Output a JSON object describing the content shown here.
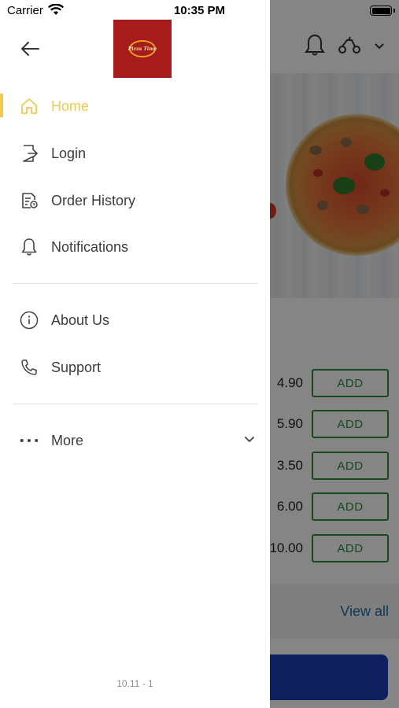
{
  "status_bar": {
    "carrier": "Carrier",
    "time": "10:35 PM"
  },
  "drawer": {
    "logo_text": "Pizza Time",
    "menu": [
      {
        "label": "Home",
        "icon": "home-icon",
        "active": true
      },
      {
        "label": "Login",
        "icon": "login-icon",
        "active": false
      },
      {
        "label": "Order History",
        "icon": "order-history-icon",
        "active": false
      },
      {
        "label": "Notifications",
        "icon": "bell-icon",
        "active": false
      },
      {
        "label": "About Us",
        "icon": "info-icon",
        "active": false
      },
      {
        "label": "Support",
        "icon": "phone-icon",
        "active": false
      },
      {
        "label": "More",
        "icon": "more-dots-icon",
        "active": false
      }
    ],
    "version": "10.11 - 1"
  },
  "background": {
    "products": [
      {
        "price": "4.90",
        "add_label": "ADD"
      },
      {
        "price": "5.90",
        "add_label": "ADD"
      },
      {
        "price": "3.50",
        "add_label": "ADD"
      },
      {
        "price": "6.00",
        "add_label": "ADD"
      },
      {
        "price": "10.00",
        "add_label": "ADD"
      }
    ],
    "view_all": "View all"
  },
  "colors": {
    "accent": "#f2c94c",
    "add_green": "#2e8b3f",
    "primary_blue": "#1c3fb5",
    "logo_red": "#a61b1b"
  }
}
